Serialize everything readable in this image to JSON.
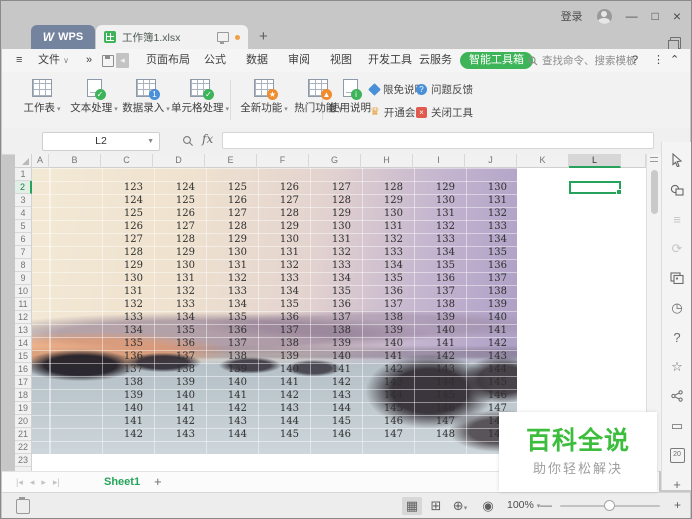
{
  "titlebar": {
    "wps_logo": "W",
    "wps_tab": "WPS",
    "doc_tab": "工作簿1.xlsx",
    "new_tab": "+",
    "login": "登录",
    "minimize": "—",
    "maximize": "□",
    "close": "×"
  },
  "menubar": {
    "items": [
      "文件",
      "页面布局",
      "公式",
      "数据",
      "审阅",
      "视图",
      "开发工具",
      "云服务"
    ],
    "overflow_chevron": "»",
    "smart_toolbox": "智能工具箱",
    "search_placeholder": "查找命令、搜索模板",
    "help": "?",
    "more": "⋮",
    "collapse": "⌃"
  },
  "toolbar": {
    "buttons": [
      {
        "label": "工作表",
        "dropdown": true
      },
      {
        "label": "文本处理",
        "dropdown": true
      },
      {
        "label": "数据录入",
        "dropdown": true
      },
      {
        "label": "单元格处理",
        "dropdown": true
      },
      {
        "label": "全新功能",
        "dropdown": true
      },
      {
        "label": "热门功能",
        "dropdown": true
      },
      {
        "label": "使用说明",
        "dropdown": false
      }
    ],
    "links": [
      "限免说明",
      "问题反馈",
      "开通会员",
      "关闭工具"
    ]
  },
  "formula_bar": {
    "name_box": "L2",
    "fx_label": "fx",
    "formula_value": ""
  },
  "grid": {
    "columns": [
      "A",
      "B",
      "C",
      "D",
      "E",
      "F",
      "G",
      "H",
      "I",
      "J",
      "K",
      "L"
    ],
    "row_count": 23,
    "selected_cell": "L2",
    "selected_column": "L",
    "selected_row": 2,
    "first_data_row": 2,
    "data_start_column": "B",
    "rows": [
      [
        123,
        124,
        125,
        126,
        127,
        128,
        129,
        130
      ],
      [
        124,
        125,
        126,
        127,
        128,
        129,
        130,
        131
      ],
      [
        125,
        126,
        127,
        128,
        129,
        130,
        131,
        132
      ],
      [
        126,
        127,
        128,
        129,
        130,
        131,
        132,
        133
      ],
      [
        127,
        128,
        129,
        130,
        131,
        132,
        133,
        134
      ],
      [
        128,
        129,
        130,
        131,
        132,
        133,
        134,
        135
      ],
      [
        129,
        130,
        131,
        132,
        133,
        134,
        135,
        136
      ],
      [
        130,
        131,
        132,
        133,
        134,
        135,
        136,
        137
      ],
      [
        131,
        132,
        133,
        134,
        135,
        136,
        137,
        138
      ],
      [
        132,
        133,
        134,
        135,
        136,
        137,
        138,
        139
      ],
      [
        133,
        134,
        135,
        136,
        137,
        138,
        139,
        140
      ],
      [
        134,
        135,
        136,
        137,
        138,
        139,
        140,
        141
      ],
      [
        135,
        136,
        137,
        138,
        139,
        140,
        141,
        142
      ],
      [
        136,
        137,
        138,
        139,
        140,
        141,
        142,
        143
      ],
      [
        137,
        138,
        139,
        140,
        141,
        142,
        143,
        144
      ],
      [
        138,
        139,
        140,
        141,
        142,
        143,
        144,
        145
      ],
      [
        139,
        140,
        141,
        142,
        143,
        144,
        145,
        146
      ],
      [
        140,
        141,
        142,
        143,
        144,
        145,
        146,
        147
      ],
      [
        141,
        142,
        143,
        144,
        145,
        146,
        147,
        148
      ],
      [
        142,
        143,
        144,
        145,
        146,
        147,
        148,
        149
      ]
    ]
  },
  "sheet_bar": {
    "active_sheet": "Sheet1",
    "add_sheet": "+"
  },
  "status_bar": {
    "zoom_level": "100%"
  },
  "watermark": {
    "title": "百科全说",
    "subtitle": "助你轻松解决"
  },
  "colors": {
    "accent_green": "#26a35a",
    "smart_toolbox_green": "#3eb458",
    "watermark_green": "#3dbd3d",
    "wps_tab_blue": "#74849f",
    "link_blue": "#4a90d9",
    "vip_orange": "#e8a33d",
    "close_red": "#e05a4e",
    "modified_dot_orange": "#f0a044"
  }
}
